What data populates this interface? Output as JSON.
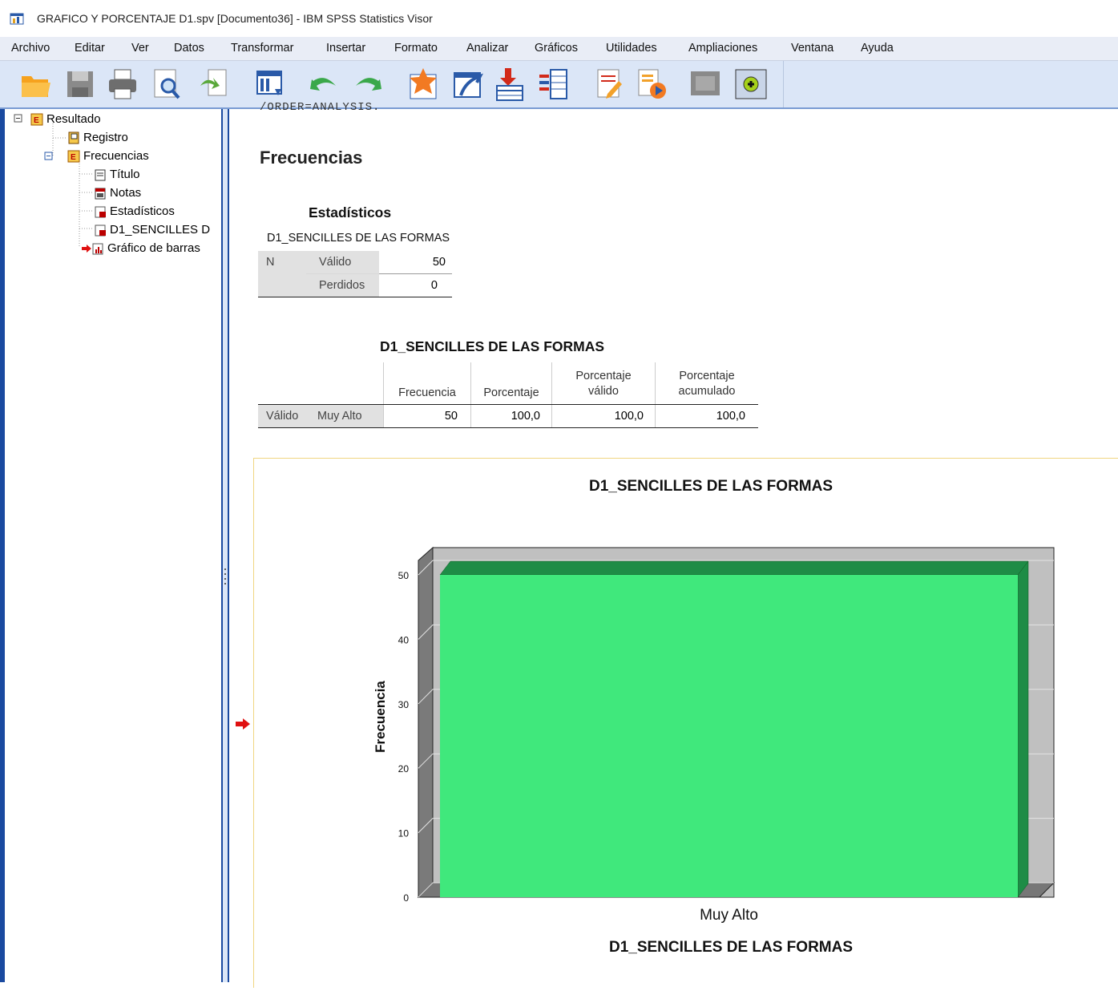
{
  "window": {
    "title": "GRAFICO Y PORCENTAJE D1.spv [Documento36] - IBM SPSS Statistics Visor"
  },
  "menu": [
    "Archivo",
    "Editar",
    "Ver",
    "Datos",
    "Transformar",
    "Insertar",
    "Formato",
    "Analizar",
    "Gráficos",
    "Utilidades",
    "Ampliaciones",
    "Ventana",
    "Ayuda"
  ],
  "toolbar_icons": [
    "open-icon",
    "save-icon",
    "print-icon",
    "print-preview-icon",
    "export-icon",
    "goto-data-icon",
    "undo-icon",
    "redo-icon",
    "goto-case-icon",
    "goto-variable-icon",
    "insert-cases-icon",
    "variables-icon",
    "edit-output-icon",
    "run-script-icon",
    "designate-window-icon",
    "add-item-icon"
  ],
  "tree": {
    "root": "Resultado",
    "log": "Registro",
    "group": "Frecuencias",
    "children": [
      "Título",
      "Notas",
      "Estadísticos",
      "D1_SENCILLES D",
      "Gráfico de barras"
    ]
  },
  "output": {
    "cut_line": "/ORDER=ANALYSIS.",
    "heading": "Frecuencias",
    "statistics": {
      "title": "Estadísticos",
      "variable": "D1_SENCILLES DE LAS FORMAS",
      "n_label": "N",
      "valid_label": "Válido",
      "valid_value": "50",
      "missing_label": "Perdidos",
      "missing_value": "0"
    },
    "freq_table": {
      "title": "D1_SENCILLES DE LAS FORMAS",
      "headers": [
        "Frecuencia",
        "Porcentaje",
        "Porcentaje válido",
        "Porcentaje acumulado"
      ],
      "header_lines": [
        [
          "Frecuencia"
        ],
        [
          "Porcentaje"
        ],
        [
          "Porcentaje",
          "válido"
        ],
        [
          "Porcentaje",
          "acumulado"
        ]
      ],
      "row_label_1": "Válido",
      "row_label_2": "Muy Alto",
      "row_values": [
        "50",
        "100,0",
        "100,0",
        "100,0"
      ]
    }
  },
  "chart_data": {
    "type": "bar",
    "title": "D1_SENCILLES DE LAS FORMAS",
    "xlabel": "D1_SENCILLES DE LAS FORMAS",
    "ylabel": "Frecuencia",
    "categories": [
      "Muy Alto"
    ],
    "values": [
      50
    ],
    "ylim": [
      0,
      50
    ],
    "yticks": [
      0,
      10,
      20,
      30,
      40,
      50
    ],
    "grid": true,
    "three_d": true,
    "colors": {
      "bar": "#40e87c",
      "bar_side": "#1e8c46",
      "wall": "#c0c0c0",
      "floor": "#777777"
    }
  }
}
